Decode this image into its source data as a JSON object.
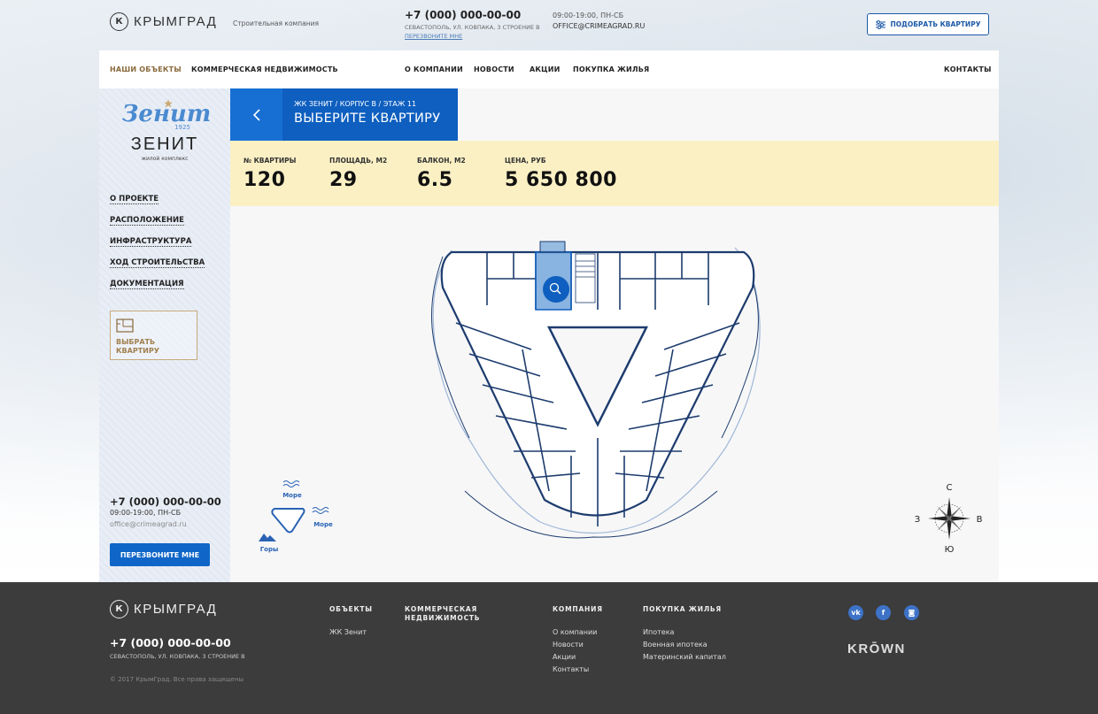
{
  "header": {
    "logo_text": "КРЫМГРАД",
    "logo_letter": "К",
    "tagline": "Строительная компания",
    "phone": "+7 (000) 000-00-00",
    "address": "Севастополь, ул. Ковпака, 3 строение В",
    "callback": "Перезвоните мне",
    "hours": "09:00-19:00, ПН-СБ",
    "email": "office@crimeagrad.ru",
    "pick_button": "Подобрать квартиру"
  },
  "nav": {
    "items": [
      "Наши объекты",
      "Коммерческая недвижимость",
      "О компании",
      "Новости",
      "Акции",
      "Покупка жилья",
      "Контакты"
    ]
  },
  "sidebar": {
    "logo_script": "Зенит",
    "logo_year": "1925",
    "logo_name": "ЗЕНИТ",
    "logo_sub": "жилой комплекс",
    "menu": [
      "О проекте",
      "Расположение",
      "Инфраструктура",
      "Ход строительства",
      "Документация"
    ],
    "choose_label_line1": "Выбрать",
    "choose_label_line2": "квартиру",
    "phone": "+7 (000) 000-00-00",
    "hours": "09:00-19:00, ПН-СБ",
    "email": "office@crimeagrad.ru",
    "callback_button": "Перезвоните мне"
  },
  "main": {
    "breadcrumb": "ЖК Зенит / корпус В / этаж 11",
    "title": "Выберите квартиру",
    "info": [
      {
        "label": "№ квартиры",
        "value": "120"
      },
      {
        "label": "Площадь, м2",
        "value": "29"
      },
      {
        "label": "Балкон, м2",
        "value": "6.5"
      },
      {
        "label": "Цена, руб",
        "value": "5 650 800"
      }
    ],
    "orientation": {
      "sea1": "Море",
      "sea2": "Море",
      "mountains": "Горы"
    },
    "compass": {
      "n": "С",
      "s": "Ю",
      "w": "З",
      "e": "В"
    },
    "colors": {
      "accent": "#0e5fbf",
      "highlight": "#4a8ad0",
      "info_bg": "#fbf0c4"
    }
  },
  "footer": {
    "logo_text": "КРЫМГРАД",
    "logo_letter": "К",
    "phone": "+7 (000) 000-00-00",
    "address": "Севастополь, ул. Ковпака, 3 строение В",
    "copyright": "© 2017 КрымГрад. Все права защищены",
    "col_objects": {
      "title": "Объекты",
      "links": [
        "ЖК Зенит"
      ]
    },
    "col_commercial": {
      "title_line1": "Коммерческая",
      "title_line2": "недвижимость"
    },
    "col_company": {
      "title": "Компания",
      "links": [
        "О компании",
        "Новости",
        "Акции",
        "Контакты"
      ]
    },
    "col_purchase": {
      "title": "Покупка жилья",
      "links": [
        "Ипотека",
        "Военная ипотека",
        "Материнский капитал"
      ]
    },
    "social": {
      "vk": "vk",
      "fb": "f",
      "ig": "◙"
    },
    "krown": "KRŌWN"
  }
}
